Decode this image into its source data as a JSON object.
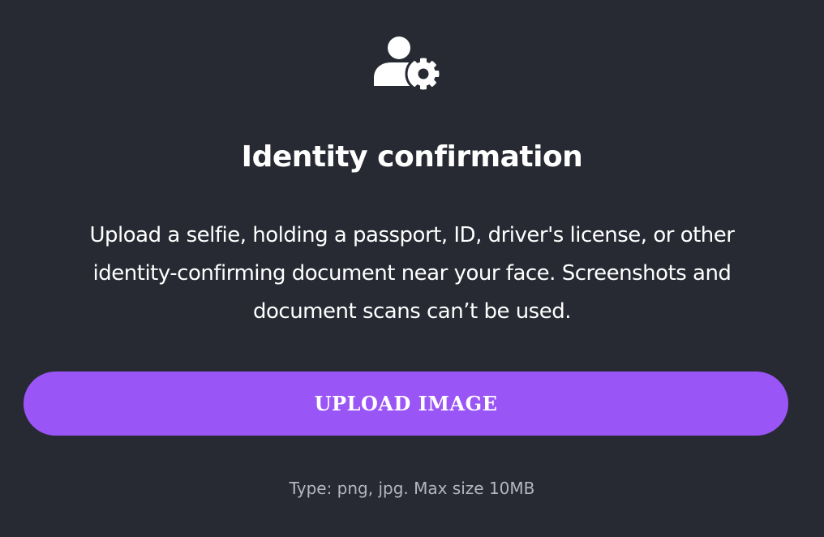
{
  "header": {
    "icon": "user-gear-icon",
    "title": "Identity confirmation"
  },
  "main": {
    "description_lines": [
      "Upload a selfie, holding a passport, ID, driver's license, or other",
      "identity-confirming document near your face. Screenshots and",
      "document scans can’t be used."
    ],
    "upload_button_label": "UPLOAD IMAGE",
    "file_hint": "Type: png, jpg. Max size 10MB"
  },
  "colors": {
    "background": "#272a33",
    "accent": "#9a55f6",
    "text": "#ffffff",
    "muted_text": "#b4b7c0"
  }
}
